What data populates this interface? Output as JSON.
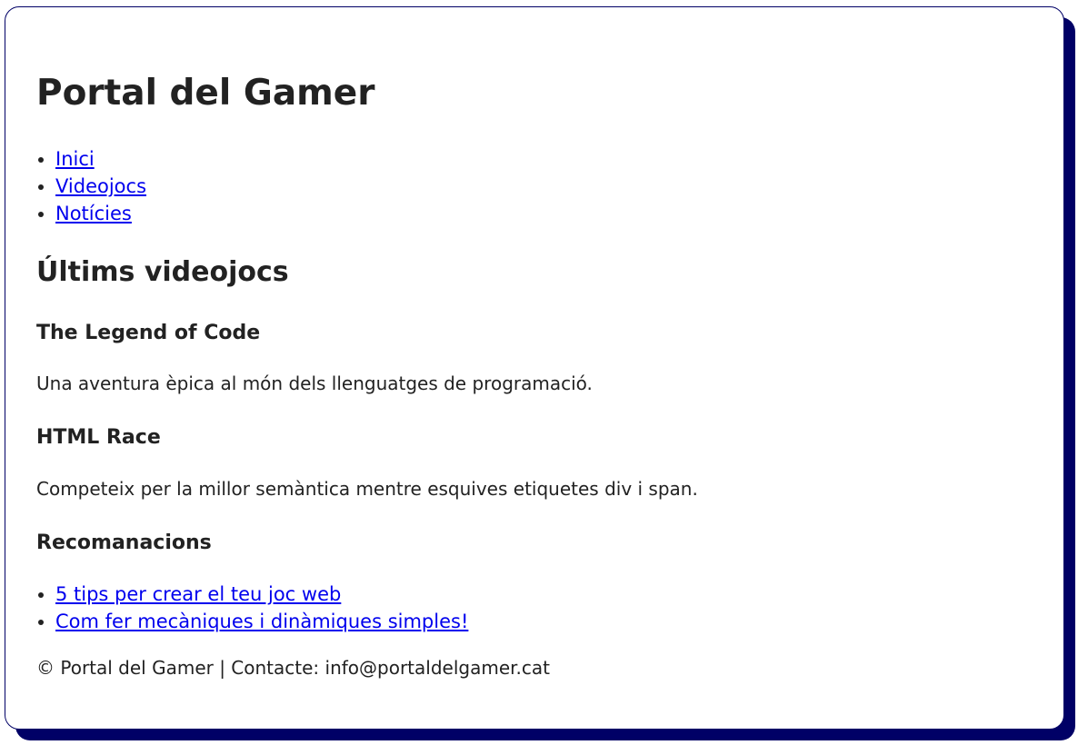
{
  "header": {
    "title": "Portal del Gamer"
  },
  "nav": {
    "items": [
      {
        "label": "Inici"
      },
      {
        "label": "Videojocs"
      },
      {
        "label": "Notícies"
      }
    ]
  },
  "main": {
    "section_title": "Últims videojocs",
    "games": [
      {
        "title": "The Legend of Code",
        "description": "Una aventura èpica al món dels llenguatges de programació."
      },
      {
        "title": "HTML Race",
        "description": "Competeix per la millor semàntica mentre esquives etiquetes div i span."
      }
    ]
  },
  "recommendations": {
    "title": "Recomanacions",
    "links": [
      {
        "label": "5 tips per crear el teu joc web"
      },
      {
        "label": "Com fer mecàniques i dinàmiques simples!"
      }
    ]
  },
  "footer": {
    "text": "© Portal del Gamer | Contacte: info@portaldelgamer.cat"
  },
  "colors": {
    "accent_shadow": "#000066",
    "link": "#0000ee",
    "text": "#222222"
  }
}
